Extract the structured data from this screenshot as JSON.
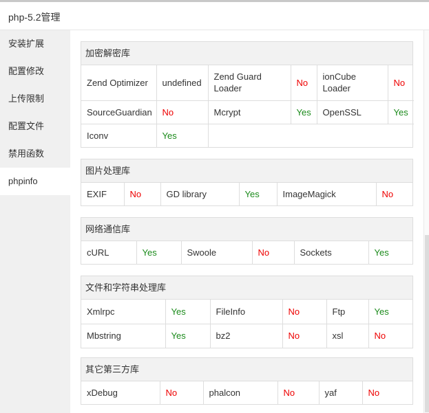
{
  "window": {
    "title": "php-5.2管理"
  },
  "sidebar": {
    "items": [
      {
        "label": "安装扩展"
      },
      {
        "label": "配置修改"
      },
      {
        "label": "上传限制"
      },
      {
        "label": "配置文件"
      },
      {
        "label": "禁用函数"
      },
      {
        "label": "phpinfo"
      }
    ],
    "active_index": 5
  },
  "sections": {
    "encryption": {
      "title": "加密解密库",
      "row1": {
        "a_name": "Zend Optimizer",
        "a_val": "undefined",
        "b_name": "Zend Guard Loader",
        "b_val": "No",
        "c_name": "ionCube Loader",
        "c_val": "No"
      },
      "row2": {
        "a_name": "SourceGuardian",
        "a_val": "No",
        "b_name": "Mcrypt",
        "b_val": "Yes",
        "c_name": "OpenSSL",
        "c_val": "Yes"
      },
      "row3": {
        "a_name": "Iconv",
        "a_val": "Yes"
      }
    },
    "image": {
      "title": "图片处理库",
      "row1": {
        "a_name": "EXIF",
        "a_val": "No",
        "b_name": "GD library",
        "b_val": "Yes",
        "c_name": "ImageMagick",
        "c_val": "No"
      }
    },
    "network": {
      "title": "网络通信库",
      "row1": {
        "a_name": "cURL",
        "a_val": "Yes",
        "b_name": "Swoole",
        "b_val": "No",
        "c_name": "Sockets",
        "c_val": "Yes"
      }
    },
    "files": {
      "title": "文件和字符串处理库",
      "row1": {
        "a_name": "Xmlrpc",
        "a_val": "Yes",
        "b_name": "FileInfo",
        "b_val": "No",
        "c_name": "Ftp",
        "c_val": "Yes"
      },
      "row2": {
        "a_name": "Mbstring",
        "a_val": "Yes",
        "b_name": "bz2",
        "b_val": "No",
        "c_name": "xsl",
        "c_val": "No"
      }
    },
    "thirdparty": {
      "title": "其它第三方库",
      "row1": {
        "a_name": "xDebug",
        "a_val": "No",
        "b_name": "phalcon",
        "b_val": "No",
        "c_name": "yaf",
        "c_val": "No"
      }
    }
  },
  "colors": {
    "yes": "#1a8a1a",
    "no": "#e00000",
    "header_bg": "#f2f2f2",
    "sidebar_bg": "#f0f0f0"
  }
}
